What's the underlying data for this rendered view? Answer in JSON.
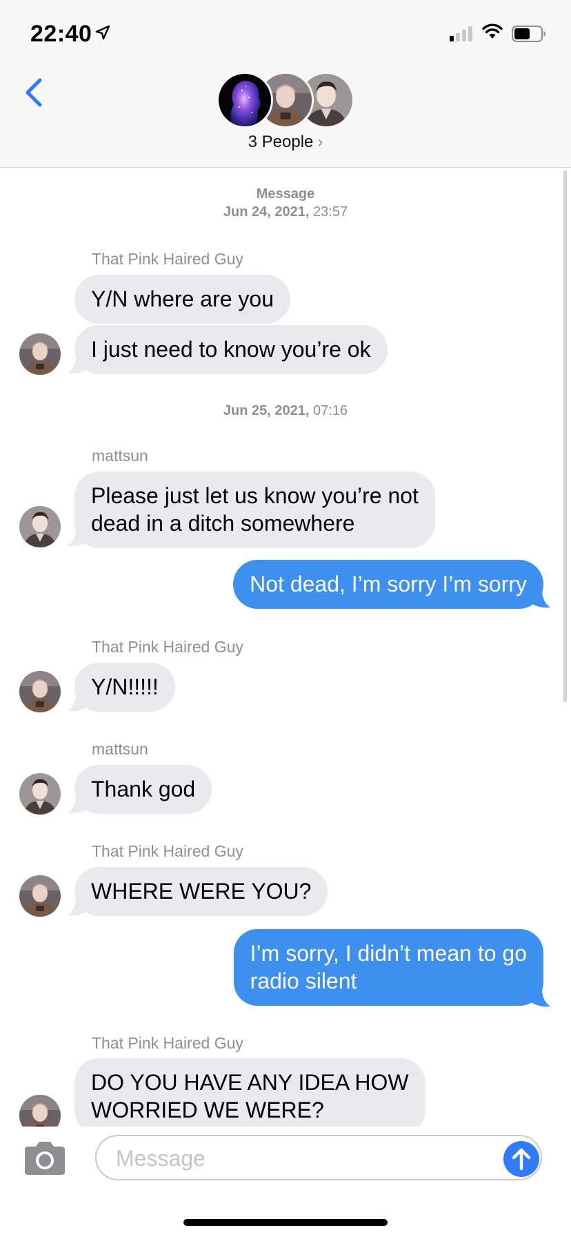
{
  "status_bar": {
    "time": "22:40",
    "icons": [
      "location-arrow-icon",
      "cellular-signal-icon",
      "wifi-icon",
      "battery-icon"
    ]
  },
  "header": {
    "back_icon": "chevron-left-icon",
    "group_label": "3 People",
    "group_chevron": "›",
    "avatars": [
      "galaxy-silhouette-avatar",
      "pink-haired-guy-avatar",
      "mattsun-avatar"
    ]
  },
  "conversation": {
    "timestamps": [
      {
        "line1": "Message",
        "date": "Jun 24, 2021,",
        "time": "23:57"
      },
      {
        "date": "Jun 25, 2021,",
        "time": "07:16"
      }
    ],
    "messages": [
      {
        "sender": "That Pink Haired Guy",
        "text": "Y/N where are you",
        "direction": "in"
      },
      {
        "text": "I just need to know you’re ok",
        "direction": "in"
      },
      {
        "sender": "mattsun",
        "text": "Please just let us know you’re not\ndead in a ditch somewhere",
        "direction": "in"
      },
      {
        "text": "Not dead, I’m sorry I’m sorry",
        "direction": "out"
      },
      {
        "sender": "That Pink Haired Guy",
        "text": "Y/N!!!!!",
        "direction": "in"
      },
      {
        "sender": "mattsun",
        "text": "Thank god",
        "direction": "in"
      },
      {
        "sender": "That Pink Haired Guy",
        "text": "WHERE WERE YOU?",
        "direction": "in"
      },
      {
        "text": "I’m sorry, I didn’t mean to go\nradio silent",
        "direction": "out"
      },
      {
        "sender": "That Pink Haired Guy",
        "text": "DO YOU HAVE ANY IDEA HOW\nWORRIED WE WERE?",
        "direction": "in"
      }
    ]
  },
  "composer": {
    "camera_icon": "camera-icon",
    "placeholder": "Message",
    "value": "",
    "send_icon": "arrow-up-icon"
  },
  "colors": {
    "accent": "#2f7cf6",
    "incoming_bubble": "#e9e9ee",
    "outgoing_bubble": "#3d8ff0",
    "bar_background": "#f7f7f8"
  }
}
